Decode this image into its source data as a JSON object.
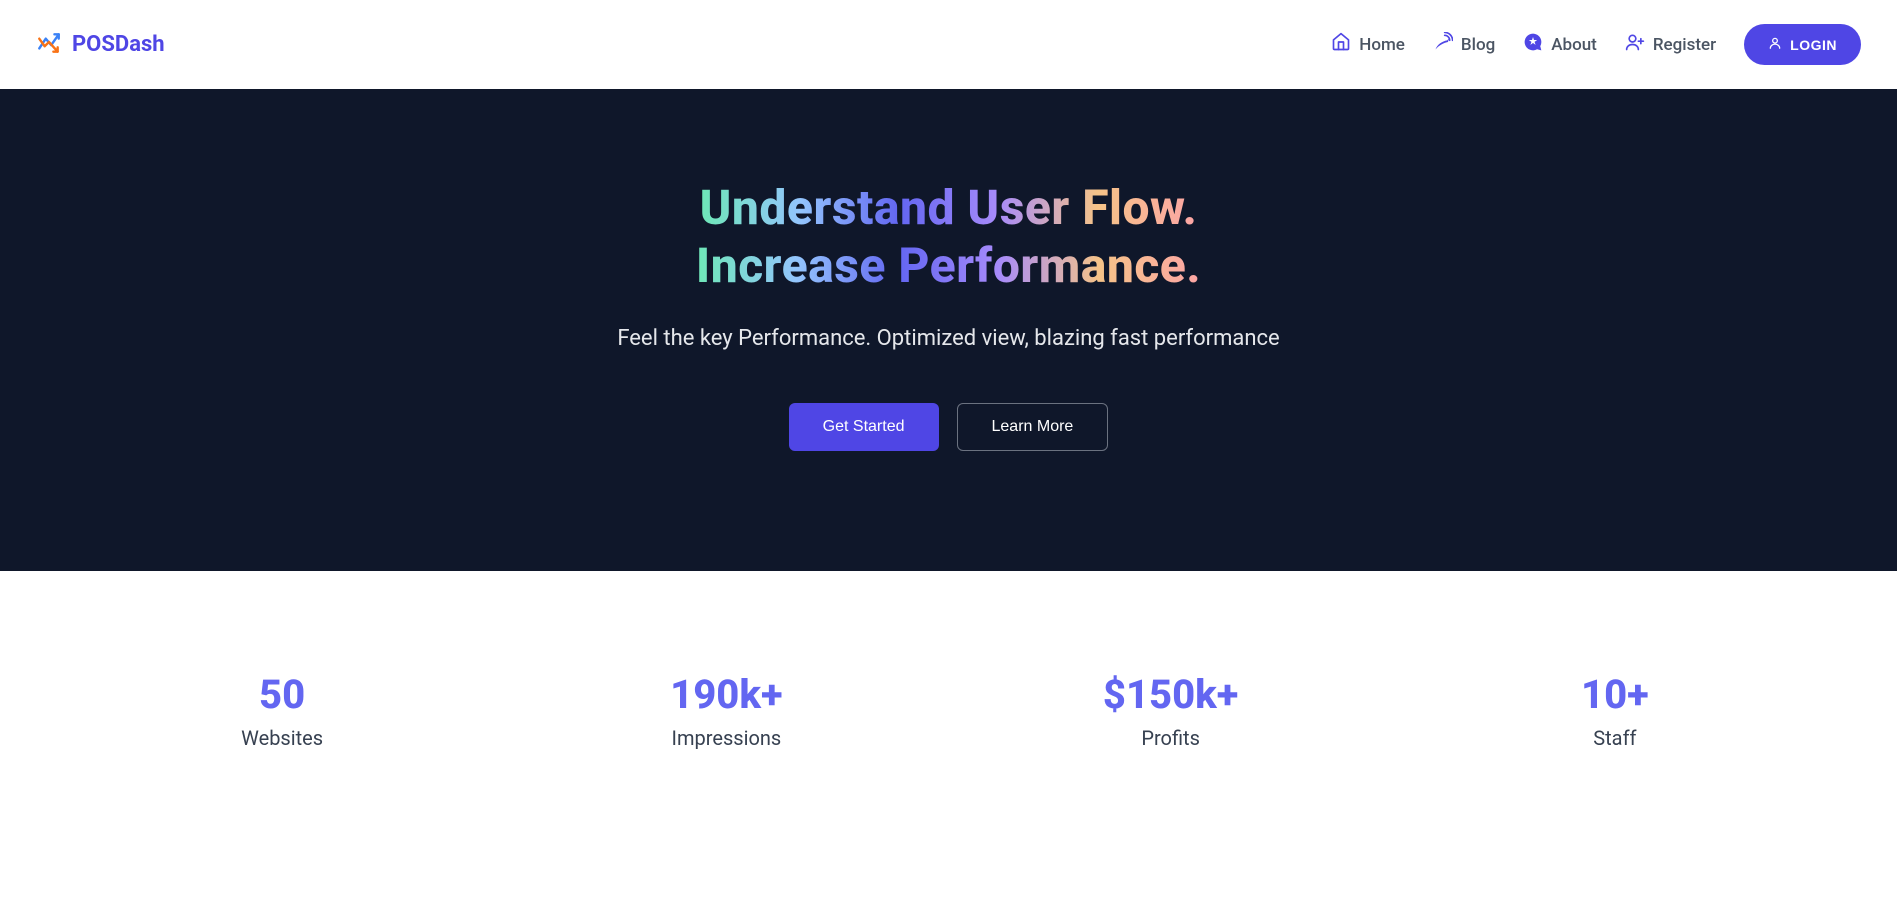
{
  "brand": {
    "name": "POSDash"
  },
  "nav": {
    "home": "Home",
    "blog": "Blog",
    "about": "About",
    "register": "Register",
    "login": "LOGIN"
  },
  "hero": {
    "title_line1": "Understand User Flow.",
    "title_line2": "Increase Performance.",
    "subtitle": "Feel the key Performance. Optimized view, blazing fast performance",
    "cta_primary": "Get Started",
    "cta_secondary": "Learn More"
  },
  "stats": [
    {
      "value": "50",
      "label": "Websites"
    },
    {
      "value": "190k+",
      "label": "Impressions"
    },
    {
      "value": "$150k+",
      "label": "Profits"
    },
    {
      "value": "10+",
      "label": "Staff"
    }
  ]
}
